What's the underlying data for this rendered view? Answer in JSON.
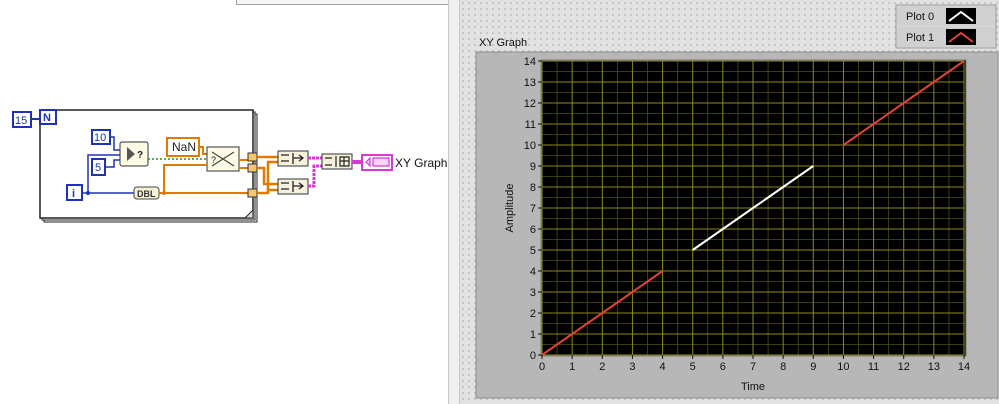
{
  "block_diagram": {
    "for_loop": {
      "count_terminal": "N",
      "count_constant": "15",
      "iteration_terminal": "i"
    },
    "constants": {
      "const_a": "10",
      "const_b": "5",
      "nan": "NaN"
    },
    "dbl_label": "DBL",
    "graph_terminal_label": "XY Graph"
  },
  "front_panel": {
    "graph_label": "XY Graph",
    "legend": [
      {
        "name": "Plot 0",
        "color": "#ffffff"
      },
      {
        "name": "Plot 1",
        "color": "#e0413a"
      }
    ]
  },
  "chart_data": {
    "type": "line",
    "title": "XY Graph",
    "xlabel": "Time",
    "ylabel": "Amplitude",
    "xlim": [
      0,
      14
    ],
    "ylim": [
      0,
      14
    ],
    "xticks": [
      "0",
      "1",
      "2",
      "3",
      "4",
      "5",
      "6",
      "7",
      "8",
      "9",
      "10",
      "11",
      "12",
      "13",
      "14"
    ],
    "yticks": [
      "0",
      "1",
      "2",
      "3",
      "4",
      "5",
      "6",
      "7",
      "8",
      "9",
      "10",
      "11",
      "12",
      "13",
      "14"
    ],
    "grid": true,
    "legend_position": "top-right",
    "series": [
      {
        "name": "Plot 0",
        "color": "#ffffff",
        "segments": [
          [
            [
              5,
              5
            ],
            [
              6,
              6
            ],
            [
              7,
              7
            ],
            [
              8,
              8
            ],
            [
              9,
              9
            ]
          ]
        ]
      },
      {
        "name": "Plot 1",
        "color": "#e0413a",
        "segments": [
          [
            [
              0,
              0
            ],
            [
              1,
              1
            ],
            [
              2,
              2
            ],
            [
              3,
              3
            ],
            [
              4,
              4
            ]
          ],
          [
            [
              10,
              10
            ],
            [
              11,
              11
            ],
            [
              12,
              12
            ],
            [
              13,
              13
            ],
            [
              14,
              14
            ]
          ]
        ]
      }
    ]
  }
}
